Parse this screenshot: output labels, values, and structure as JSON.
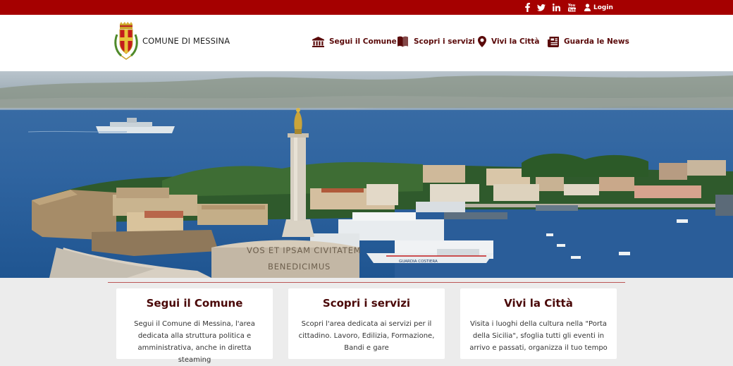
{
  "topbar": {
    "social_icons": [
      "facebook-icon",
      "twitter-icon",
      "linkedin-icon",
      "youtube-icon"
    ],
    "login_label": "Login"
  },
  "header": {
    "brand": "COMUNE DI MESSINA",
    "nav": [
      {
        "label": "Segui il Comune",
        "icon": "building-icon"
      },
      {
        "label": "Scopri i servizi",
        "icon": "book-icon"
      },
      {
        "label": "Vivi la Città",
        "icon": "map-pin-icon"
      },
      {
        "label": "Guarda le News",
        "icon": "newspaper-icon"
      }
    ]
  },
  "hero": {
    "inscription_line1": "VOS ET IPSAM CIVITATEM",
    "inscription_line2": "BENEDICIMUS",
    "ship_label": "GUARDIA COSTIERA"
  },
  "cards": [
    {
      "title": "Segui il Comune",
      "text": "Segui il Comune di Messina, l'area dedicata alla struttura politica e amministrativa, anche in diretta steaming"
    },
    {
      "title": "Scopri i servizi",
      "text": "Scopri l'area dedicata ai servizi per il cittadino. Lavoro, Edilizia, Formazione, Bandi e gare"
    },
    {
      "title": "Vivi la Città",
      "text": "Visita i luoghi della cultura nella \"Porta della Sicilia\", sfoglia tutti gli eventi in arrivo e passati, organizza il tuo tempo"
    }
  ],
  "colors": {
    "brand_red": "#a50000",
    "nav_text": "#5a0a0a",
    "card_title": "#4a0808"
  }
}
